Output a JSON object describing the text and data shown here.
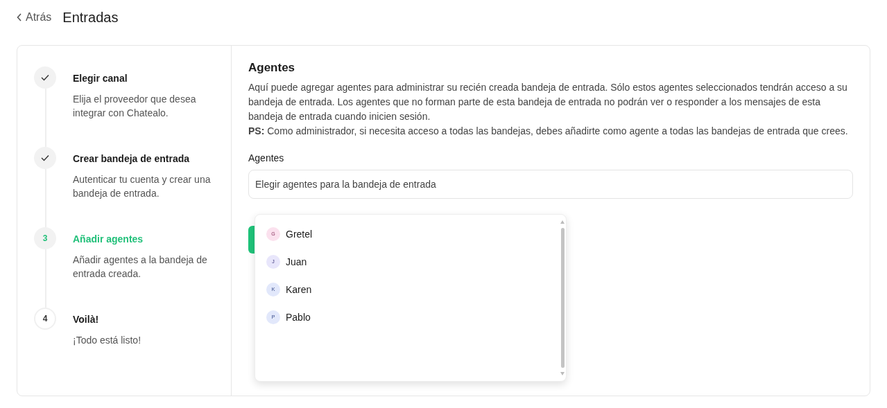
{
  "header": {
    "back": "Atrás",
    "title": "Entradas"
  },
  "steps": [
    {
      "done": true,
      "selected": false,
      "title": "Elegir canal",
      "description": "Elija el proveedor que desea integrar con Chatealo."
    },
    {
      "done": true,
      "selected": false,
      "title": "Crear bandeja de entrada",
      "description": "Autenticar tu cuenta y crear una bandeja de entrada."
    },
    {
      "number": "3",
      "done": false,
      "selected": true,
      "title": "Añadir agentes",
      "description": "Añadir agentes a la bandeja de entrada creada."
    },
    {
      "number": "4",
      "done": false,
      "selected": false,
      "title": "Voilà!",
      "description": "¡Todo está listo!"
    }
  ],
  "section": {
    "title": "Agentes",
    "description": "Aquí puede agregar agentes para administrar su recién creada bandeja de entrada. Sólo estos agentes seleccionados tendrán acceso a su bandeja de entrada. Los agentes que no forman parte de esta bandeja de entrada no podrán ver o responder a los mensajes de esta bandeja de entrada cuando inicien sesión.",
    "note": "**PS:** Como administrador, si necesita acceso a todas las bandejas, debes añadirte como agente a todas las bandejas de entrada que crees."
  },
  "field": {
    "label": "Agentes",
    "placeholder": "Elegir agentes para la bandeja de entrada"
  },
  "options": [
    {
      "initial": "G",
      "name": "Gretel",
      "color": "#fbe1ee"
    },
    {
      "initial": "J",
      "name": "Juan",
      "color": "#e8e6fb"
    },
    {
      "initial": "K",
      "name": "Karen",
      "color": "#e2e8fb"
    },
    {
      "initial": "P",
      "name": "Pablo",
      "color": "#e2e8fb"
    }
  ]
}
